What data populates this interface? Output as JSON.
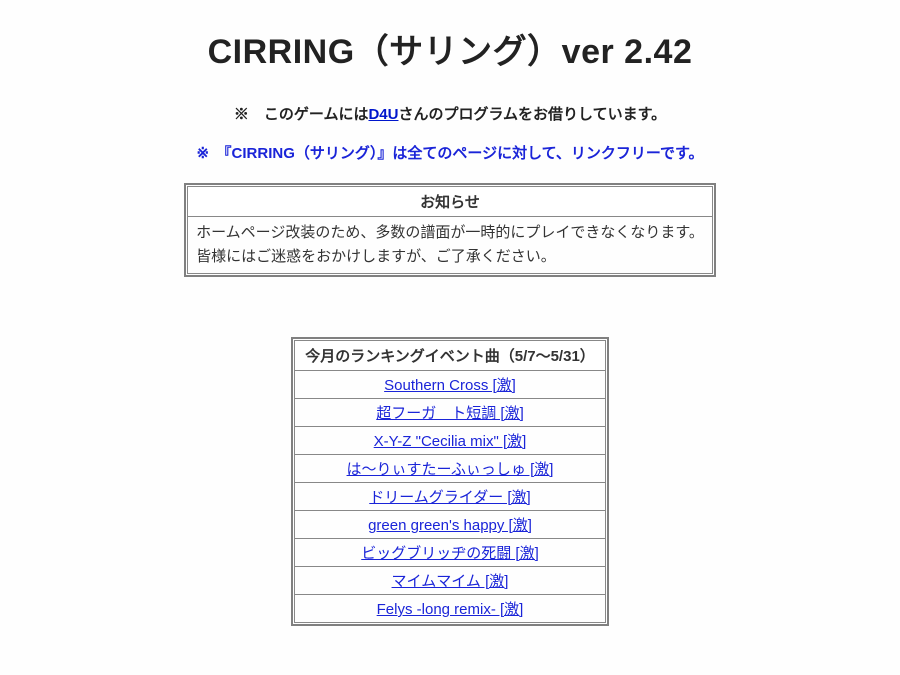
{
  "title": "CIRRING（サリング）ver 2.42",
  "notice1_prefix": "※　このゲームには",
  "notice1_link": "D4U",
  "notice1_suffix": "さんのプログラムをお借りしています。",
  "notice2": "※　『CIRRING（サリング）』は全てのページに対して、リンクフリーです。",
  "announce": {
    "heading": "お知らせ",
    "body_line1": "ホームページ改装のため、多数の譜面が一時的にプレイできなくなります。",
    "body_line2": "皆様にはご迷惑をおかけしますが、ご了承ください。"
  },
  "ranking": {
    "heading": "今月のランキングイベント曲（5/7～5/31）",
    "songs": [
      "Southern Cross [激]",
      "超フーガ　ト短調 [激]",
      "X-Y-Z \"Cecilia mix\" [激]",
      "は～りぃすたーふぃっしゅ [激]",
      "ドリームグライダー [激]",
      "green green's happy [激]",
      "ビッグブリッヂの死闘 [激]",
      "マイムマイム [激]",
      "Felys -long remix- [激]"
    ]
  }
}
